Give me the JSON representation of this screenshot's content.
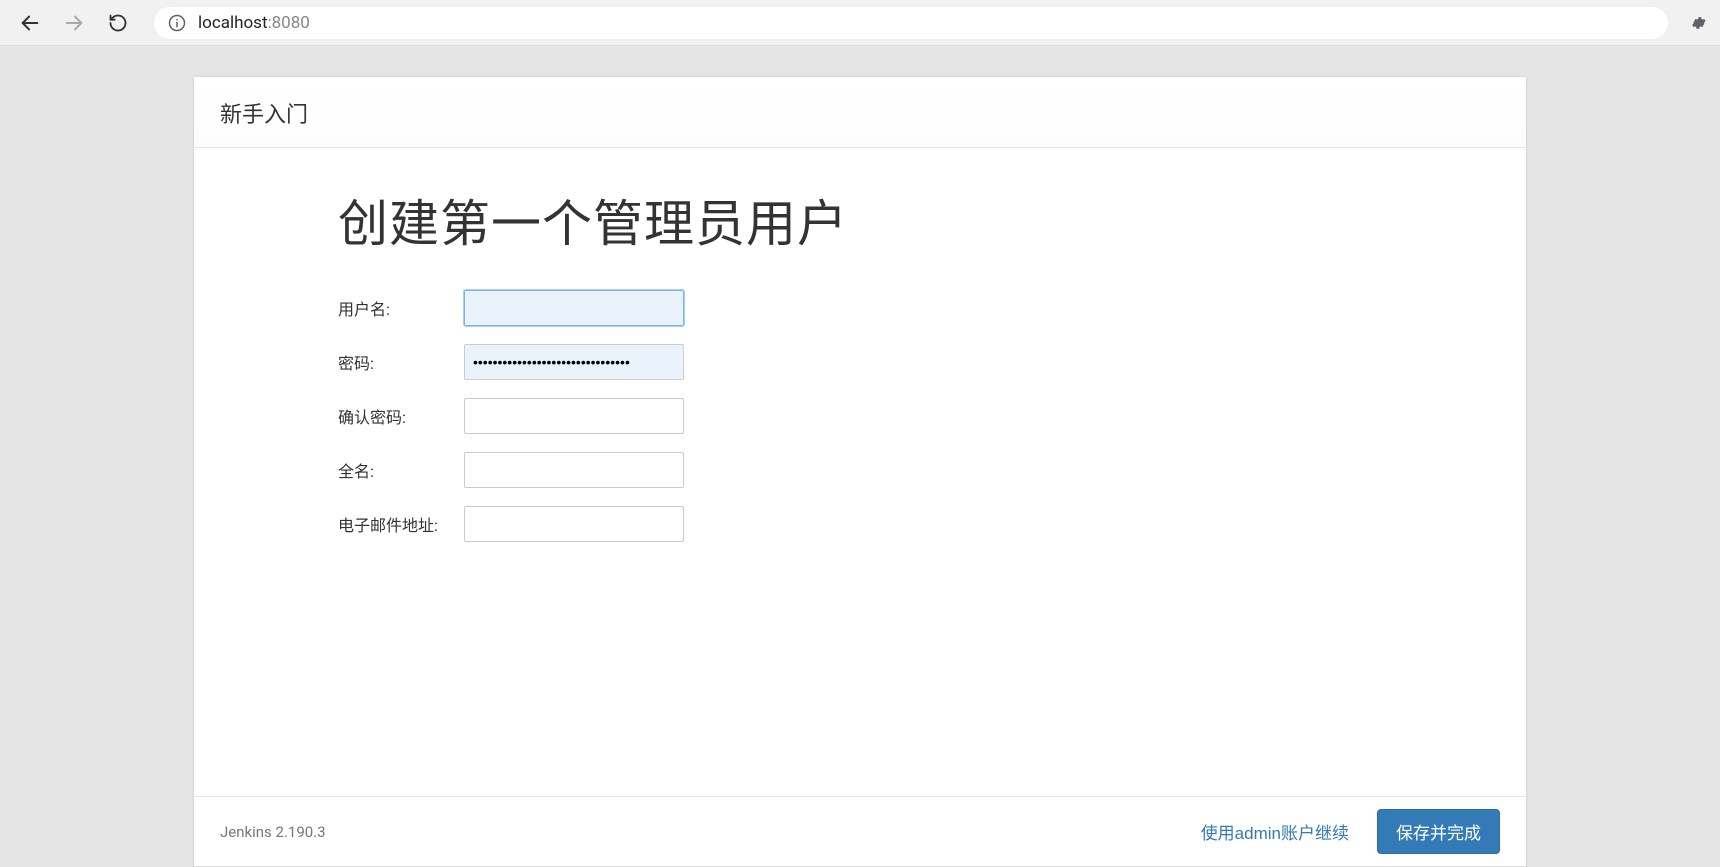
{
  "browser": {
    "url_host": "localhost",
    "url_port": ":8080"
  },
  "modal": {
    "header": "新手入门",
    "title": "创建第一个管理员用户",
    "form": {
      "username": {
        "label": "用户名:",
        "value": ""
      },
      "password": {
        "label": "密码:",
        "value": "••••••••••••••••••••••••••••••••"
      },
      "confirm": {
        "label": "确认密码:",
        "value": ""
      },
      "fullname": {
        "label": "全名:",
        "value": ""
      },
      "email": {
        "label": "电子邮件地址:",
        "value": ""
      }
    },
    "footer": {
      "version": "Jenkins 2.190.3",
      "continue_as_admin": "使用admin账户继续",
      "save_and_finish": "保存并完成"
    }
  }
}
